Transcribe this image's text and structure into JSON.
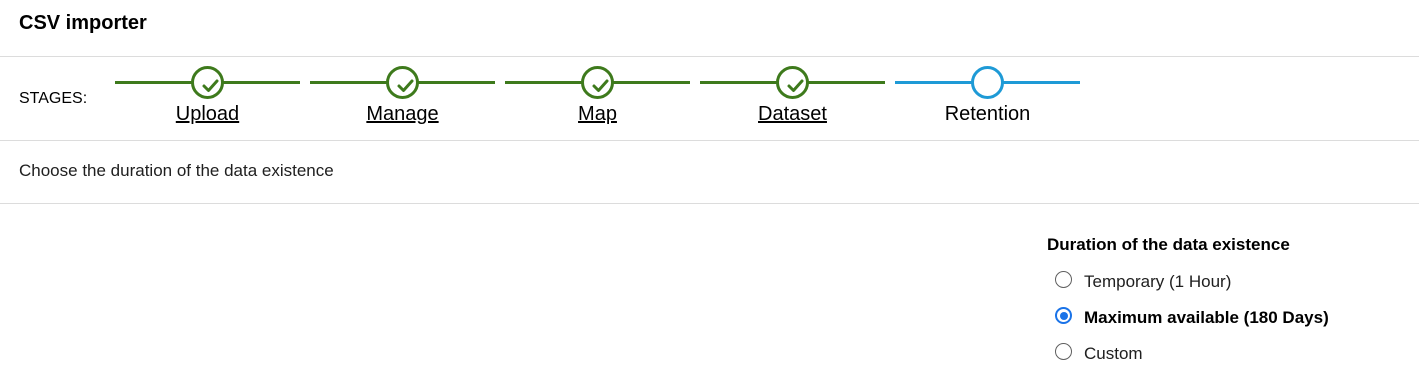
{
  "header": {
    "title": "CSV importer"
  },
  "stages": {
    "label": "STAGES:",
    "completed_color": "#3e7a1c",
    "active_color": "#1e9ad6",
    "items": [
      {
        "label": "Upload",
        "status": "completed",
        "icon": "check-icon"
      },
      {
        "label": "Manage",
        "status": "completed",
        "icon": "check-icon"
      },
      {
        "label": "Map",
        "status": "completed",
        "icon": "check-icon"
      },
      {
        "label": "Dataset",
        "status": "completed",
        "icon": "check-icon"
      },
      {
        "label": "Retention",
        "status": "active",
        "icon": "circle-icon"
      }
    ]
  },
  "instruction": "Choose the duration of the data existence",
  "duration": {
    "title": "Duration of the data existence",
    "selected_color": "#1a73e8",
    "options": [
      {
        "label": "Temporary (1 Hour)",
        "checked": false
      },
      {
        "label": "Maximum available (180 Days)",
        "checked": true
      },
      {
        "label": "Custom",
        "checked": false
      }
    ]
  }
}
